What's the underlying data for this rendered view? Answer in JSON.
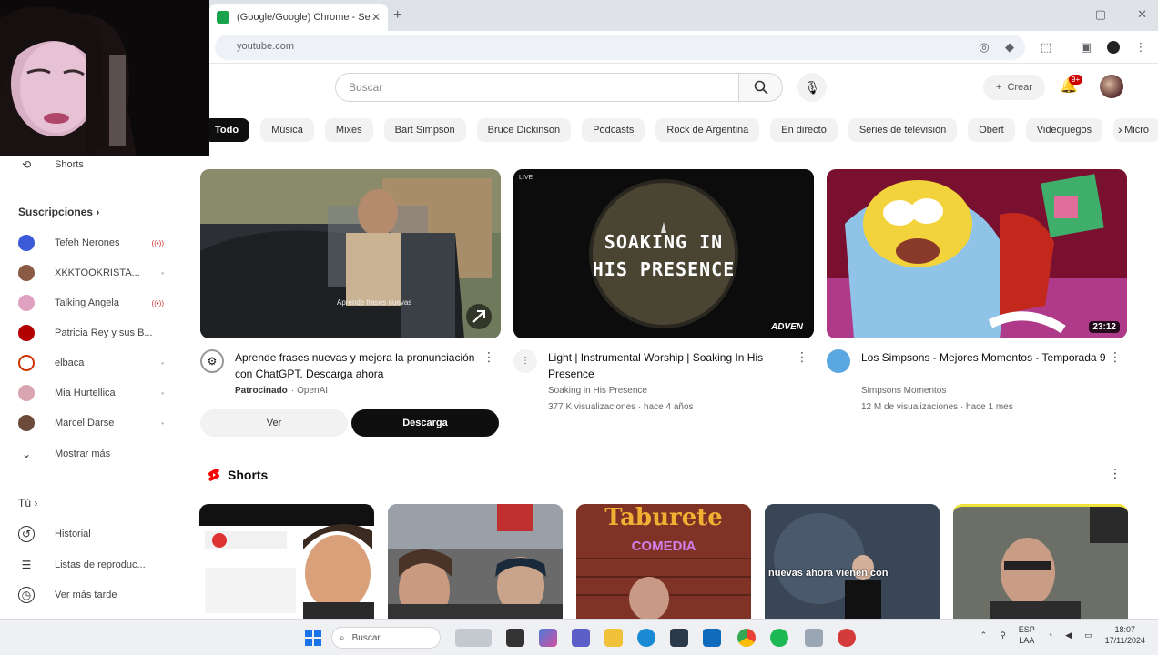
{
  "browser": {
    "tab_title": "(Google/Google) Chrome - Search",
    "tab_close": "✕",
    "new_tab": "+",
    "url": "youtube.com",
    "window_controls": [
      "—",
      "▢",
      "✕"
    ]
  },
  "youtube": {
    "search_placeholder": "Buscar",
    "create_label": "Crear",
    "notifications_badge": "9+",
    "chips": [
      "Todo",
      "Música",
      "Mixes",
      "Bart Simpson",
      "Bruce Dickinson",
      "Pódcasts",
      "Rock de Argentina",
      "En directo",
      "Series de televisión",
      "Obert",
      "Videojuegos",
      "Micro"
    ]
  },
  "sidebar": {
    "shorts_label": "Shorts",
    "subscriptions_heading": "Suscripciones",
    "subscriptions": [
      {
        "label": "Tefeh Nerones",
        "color": "#3b5bdb",
        "live": true
      },
      {
        "label": "XKKTOOKRISTA...",
        "color": "#8a5a44",
        "live": false
      },
      {
        "label": "Talking Angela",
        "color": "#e0a0c0",
        "live": true
      },
      {
        "label": "Patricia Rey y sus B...",
        "color": "#b30000",
        "live": false
      },
      {
        "label": "elbaca",
        "color": "#cc3300",
        "live": false
      },
      {
        "label": "Mia Hurtellica",
        "color": "#d9a5b0",
        "live": false
      },
      {
        "label": "Marcel Darse",
        "color": "#6b4a3a",
        "live": false
      }
    ],
    "show_more": "Mostrar más",
    "you_heading": "Tú",
    "you_items": [
      {
        "label": "Historial",
        "icon": "history-icon"
      },
      {
        "label": "Listas de reproduc...",
        "icon": "playlist-icon"
      },
      {
        "label": "Ver más tarde",
        "icon": "clock-icon"
      }
    ]
  },
  "videos": [
    {
      "title": "Aprende frases nuevas y mejora la pronunciación con ChatGPT. Descarga ahora",
      "channel": "Patrocinado",
      "stats": "· OpenAI",
      "duration": "",
      "ad_buttons": {
        "ver": "Ver",
        "descarga": "Descarga"
      },
      "caption": "Aprende frases nuevas"
    },
    {
      "title": "Light | Instrumental Worship | Soaking In His Presence",
      "channel": "Soaking in His Presence",
      "stats": "377 K visualizaciones · hace 4 años",
      "duration": "ADVEN",
      "thumb_text_top": "SOAKING IN",
      "thumb_text_bottom": "HIS PRESENCE",
      "thumb_label": "LIVE"
    },
    {
      "title": "Los Simpsons - Mejores Momentos - Temporada 9",
      "channel": "Simpsons Momentos",
      "stats": "12 M de visualizaciones · hace 1 mes",
      "duration": "23:12"
    }
  ],
  "shorts": {
    "heading": "Shorts",
    "items": [
      {
        "caption": ""
      },
      {
        "caption": ""
      },
      {
        "caption": "COMEDIA",
        "headline": "Taburete"
      },
      {
        "caption": "nuevas ahora vienen con"
      },
      {
        "caption": ""
      }
    ]
  },
  "taskbar": {
    "search_label": "Buscar",
    "lang": "ESP\nLAA",
    "time": "18:07",
    "date": "17/11/2024"
  },
  "colors": {
    "accent_red": "#ff0000",
    "chip_active": "#0f0f0f"
  }
}
